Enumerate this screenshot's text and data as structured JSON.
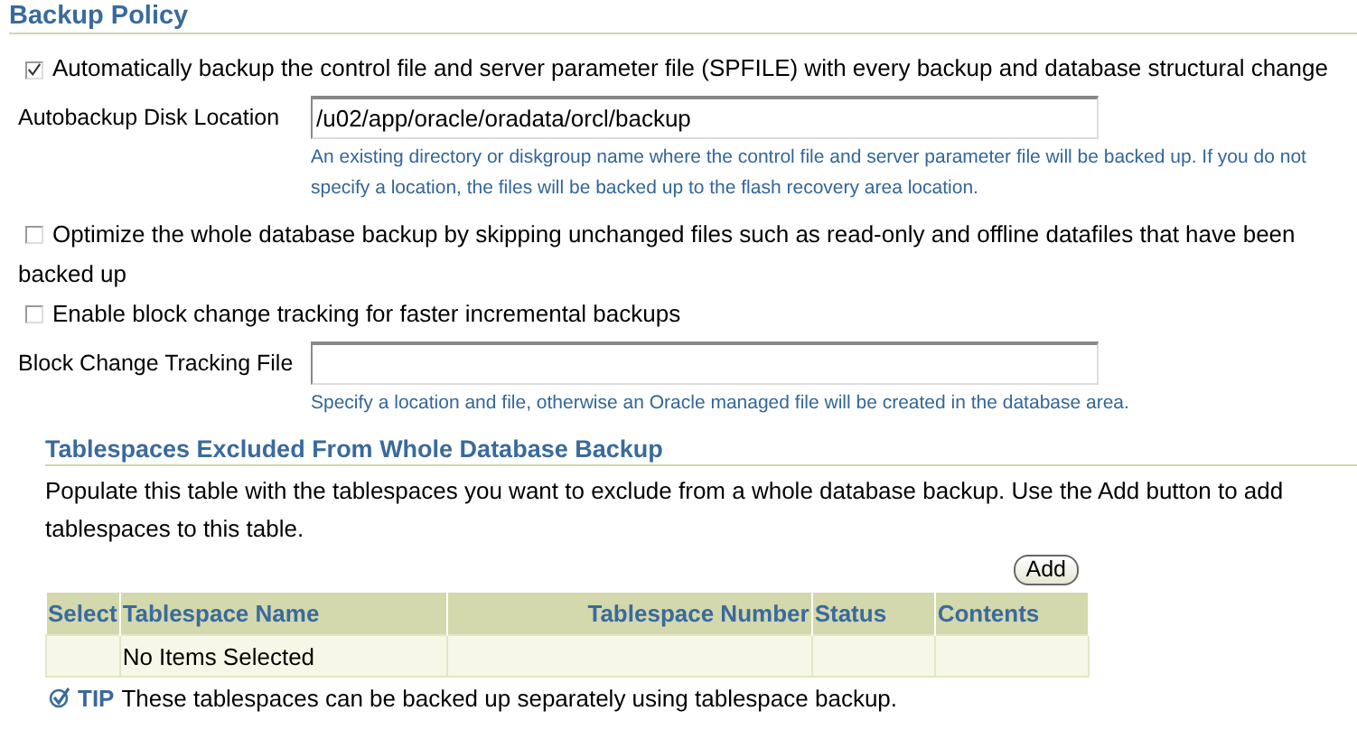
{
  "title": "Backup Policy",
  "options": [
    {
      "kind": "checkbox",
      "label": "Automatically backup the control file and server parameter file (SPFILE) with every backup and database structural change",
      "checked": true
    },
    {
      "kind": "field",
      "label": "Autobackup Disk Location",
      "value": "/u02/app/oracle/oradata/orcl/backup",
      "hint": "An existing directory or diskgroup name where the control file and server parameter file will be backed up. If you do not specify a location, the files will be backed up to the flash recovery area location."
    },
    {
      "kind": "checkbox",
      "label": "Optimize the whole database backup by skipping unchanged files such as read-only and offline datafiles that have been backed up",
      "checked": false
    },
    {
      "kind": "checkbox",
      "label": "Enable block change tracking for faster incremental backups",
      "checked": false
    },
    {
      "kind": "field",
      "label": "Block Change Tracking File",
      "hint": "Specify a location and file, otherwise an Oracle managed file will be created in the database area."
    }
  ],
  "section": {
    "title": "Tablespaces Excluded From Whole Database Backup",
    "description": "Populate this table with the tablespaces you want to exclude from a whole database backup. Use the Add button to add tablespaces to this table.",
    "add_button": "Add",
    "table": {
      "columns": [
        "Select",
        "Tablespace Name",
        "Tablespace Number",
        "Status",
        "Contents"
      ],
      "rows": [
        [
          null,
          "No Items Selected",
          null,
          null,
          null
        ]
      ]
    },
    "tip_label": "TIP",
    "tip": "These tablespaces can be backed up separately using tablespace backup."
  }
}
